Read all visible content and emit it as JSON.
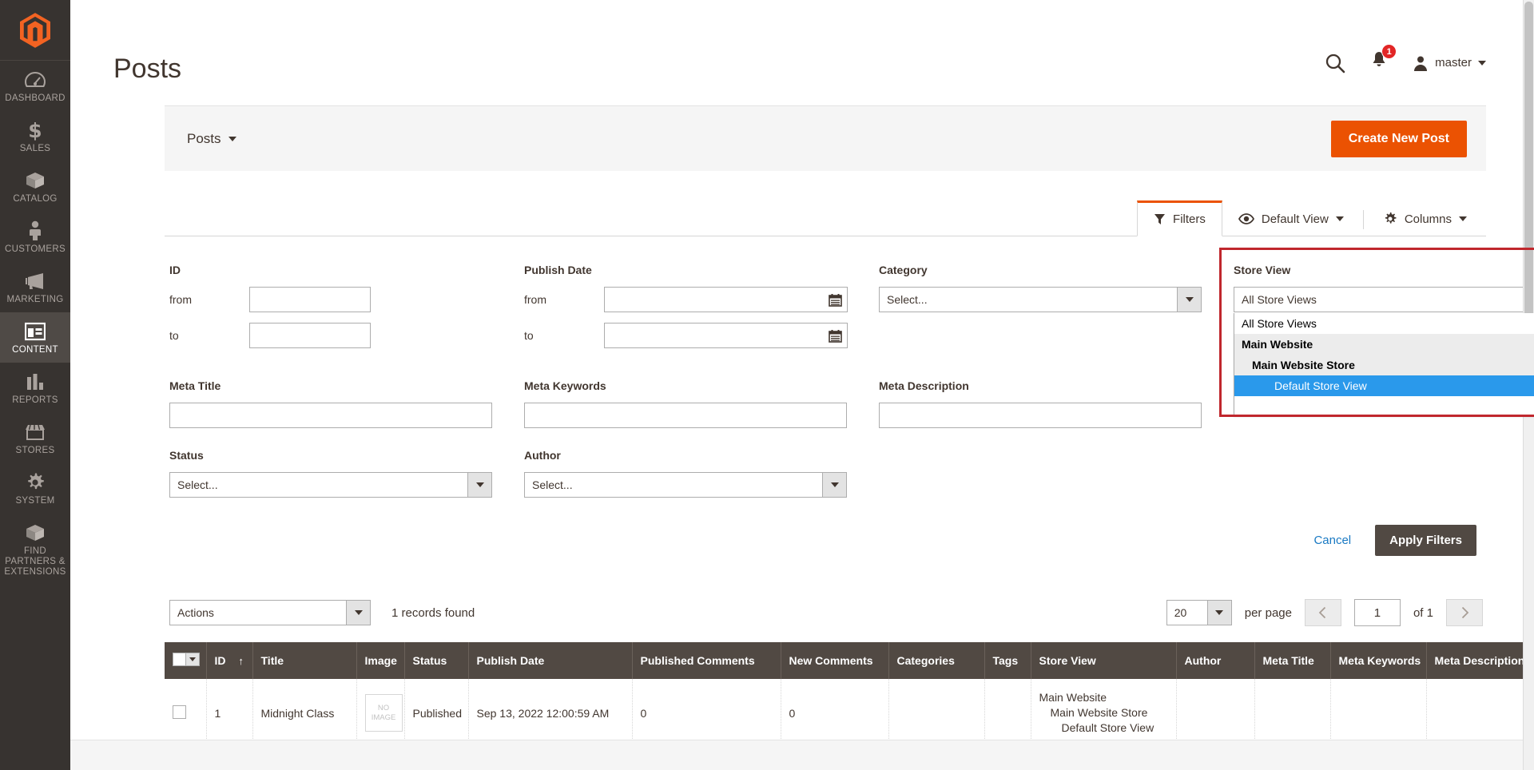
{
  "sidebar": {
    "logo_name": "magento-logo",
    "items": [
      {
        "label": "DASHBOARD",
        "icon": "dashboard-gauge-icon",
        "active": false
      },
      {
        "label": "SALES",
        "icon": "dollar-sign-icon",
        "active": false
      },
      {
        "label": "CATALOG",
        "icon": "box-icon",
        "active": false
      },
      {
        "label": "CUSTOMERS",
        "icon": "person-icon",
        "active": false
      },
      {
        "label": "MARKETING",
        "icon": "megaphone-icon",
        "active": false
      },
      {
        "label": "CONTENT",
        "icon": "layout-panel-icon",
        "active": true
      },
      {
        "label": "REPORTS",
        "icon": "bar-chart-icon",
        "active": false
      },
      {
        "label": "STORES",
        "icon": "storefront-icon",
        "active": false
      },
      {
        "label": "SYSTEM",
        "icon": "gear-icon",
        "active": false
      },
      {
        "label": "FIND PARTNERS & EXTENSIONS",
        "icon": "extension-box-icon",
        "active": false
      }
    ]
  },
  "header": {
    "title": "Posts",
    "search_icon": "search-icon",
    "notifications_icon": "bell-icon",
    "notifications_count": "1",
    "user_icon": "user-avatar-icon",
    "user_name": "master"
  },
  "posts_bar": {
    "switcher_label": "Posts",
    "create_button": "Create New Post"
  },
  "toolbar": {
    "filters_label": "Filters",
    "default_view_label": "Default View",
    "columns_label": "Columns"
  },
  "filters": {
    "id": {
      "label": "ID",
      "from_label": "from",
      "to_label": "to",
      "from_value": "",
      "to_value": ""
    },
    "publish_date": {
      "label": "Publish Date",
      "from_label": "from",
      "to_label": "to",
      "from_value": "",
      "to_value": "",
      "calendar_icon": "calendar-icon"
    },
    "category": {
      "label": "Category",
      "value": "Select..."
    },
    "store_view": {
      "label": "Store View",
      "value": "All Store Views",
      "options": [
        {
          "label": "All Store Views",
          "type": "option",
          "selected": false
        },
        {
          "label": "Main Website",
          "type": "group",
          "selected": false
        },
        {
          "label": "Main Website Store",
          "type": "subgroup",
          "selected": false
        },
        {
          "label": "Default Store View",
          "type": "option",
          "selected": true
        }
      ]
    },
    "meta_title": {
      "label": "Meta Title",
      "value": ""
    },
    "meta_keywords": {
      "label": "Meta Keywords",
      "value": ""
    },
    "meta_description": {
      "label": "Meta Description",
      "value": ""
    },
    "status": {
      "label": "Status",
      "value": "Select..."
    },
    "author": {
      "label": "Author",
      "value": "Select..."
    },
    "cancel_label": "Cancel",
    "apply_label": "Apply Filters"
  },
  "grid_controls": {
    "actions_label": "Actions",
    "records_found": "1 records found",
    "per_page_value": "20",
    "per_page_label": "per page",
    "prev_icon": "chevron-left-icon",
    "next_icon": "chevron-right-icon",
    "page_value": "1",
    "page_of": "of 1"
  },
  "grid": {
    "columns": [
      "ID",
      "Title",
      "Image",
      "Status",
      "Publish Date",
      "Published Comments",
      "New Comments",
      "Categories",
      "Tags",
      "Store View",
      "Author",
      "Meta Title",
      "Meta Keywords",
      "Meta Description"
    ],
    "sorted_column": "ID",
    "sort_arrow": "↑",
    "rows": [
      {
        "id": "1",
        "title": "Midnight Class",
        "image": "NO IMAGE",
        "image_line1": "NO",
        "image_line2": "IMAGE",
        "status": "Published",
        "publish_date": "Sep 13, 2022 12:00:59 AM",
        "published_comments": "0",
        "new_comments": "0",
        "categories": "",
        "tags": "",
        "store_view_1": "Main Website",
        "store_view_2": "Main Website Store",
        "store_view_3": "Default Store View",
        "author": "",
        "meta_title": "",
        "meta_keywords": "",
        "meta_description": ""
      }
    ]
  },
  "colors": {
    "brand_orange": "#eb5202",
    "sidebar_bg": "#373330",
    "table_header_bg": "#514943",
    "highlight_border": "#c0272d",
    "selected_option_bg": "#2a99eb",
    "link_blue": "#1979c3",
    "published_green": "#5a8f29"
  }
}
